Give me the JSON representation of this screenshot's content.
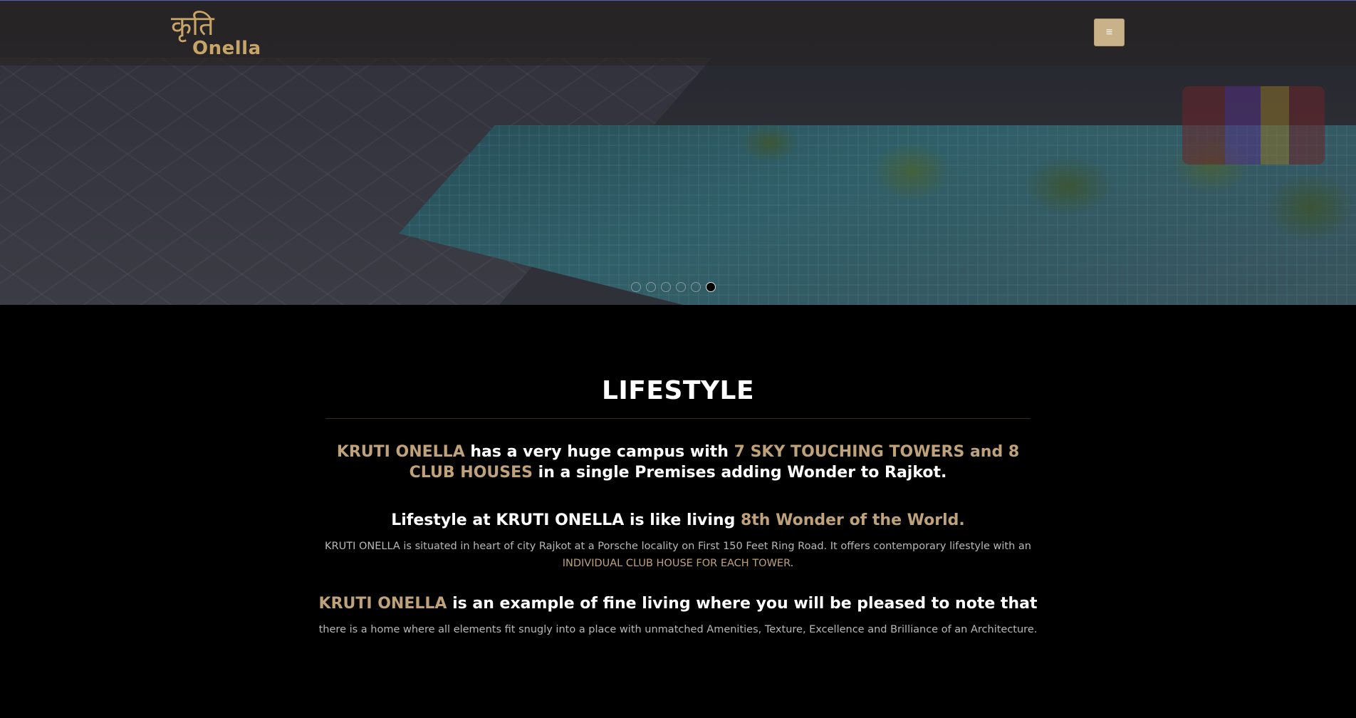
{
  "brand": {
    "logo_devanagari": "कृति",
    "logo_latin": "Onella",
    "accent_color": "#c7a467"
  },
  "header": {
    "menu_icon": "hamburger-menu-icon",
    "menu_glyph": "≡"
  },
  "carousel": {
    "slide_count": 6,
    "active_index": 5
  },
  "lifestyle": {
    "title": "LIFESTYLE",
    "intro": {
      "part1": "KRUTI ONELLA",
      "part2": " has a very huge campus with ",
      "part3": "7 SKY TOUCHING TOWERS and 8 CLUB HOUSES",
      "part4": " in a single Premises adding Wonder to Rajkot."
    },
    "heading2": {
      "part1": "Lifestyle at KRUTI ONELLA is like living ",
      "part2": "8th Wonder of the World."
    },
    "paragraph1": {
      "text": "KRUTI ONELLA is situated in heart of city Rajkot at a Porsche locality on First 150 Feet Ring Road. It offers contemporary lifestyle with an ",
      "highlight": "INDIVIDUAL CLUB HOUSE FOR EACH TOWER",
      "end": "."
    },
    "heading3": {
      "part1": "KRUTI ONELLA",
      "part2": " is an example of fine living where you will be pleased to note that"
    },
    "paragraph2": "there is a home where all elements fit snugly into a place with unmatched Amenities, Texture, Excellence and Brilliance of an Architecture."
  }
}
